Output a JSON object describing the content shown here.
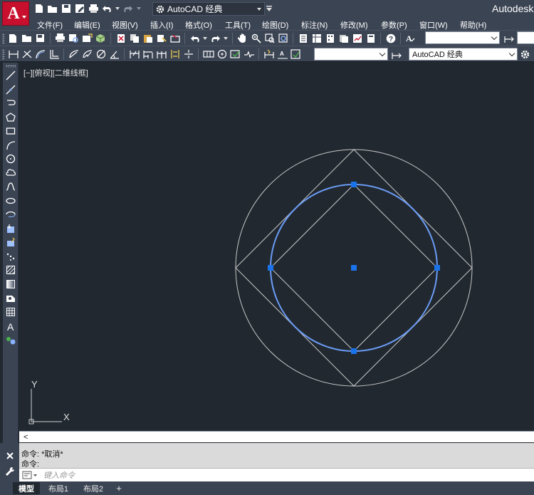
{
  "app": {
    "logo_letter": "A",
    "brand": "Autodesk"
  },
  "quick_access": {
    "workspace": "AutoCAD 经典"
  },
  "menu": {
    "items": [
      "文件(F)",
      "编辑(E)",
      "视图(V)",
      "插入(I)",
      "格式(O)",
      "工具(T)",
      "绘图(D)",
      "标注(N)",
      "修改(M)",
      "参数(P)",
      "窗口(W)",
      "帮助(H)"
    ]
  },
  "toolbars": {
    "layer_combo_value": "",
    "linetype_combo_value": "",
    "style_combo_value": "AutoCAD 经典"
  },
  "viewport": {
    "label": "[−][俯视][二维线框]",
    "ucs_x": "X",
    "ucs_y": "Y"
  },
  "command_history": {
    "line1": "命令: *取消*",
    "line2": "命令:"
  },
  "command_line": {
    "placeholder": "键入命令"
  },
  "tabs": {
    "model": "模型",
    "layout1": "布局1",
    "layout2": "布局2",
    "add": "+"
  },
  "colors": {
    "canvas": "#212830",
    "chrome": "#3b4453",
    "selected_circle": "#6b9cf5",
    "grip": "#1a73e8",
    "geometry": "#c8c8c8"
  }
}
